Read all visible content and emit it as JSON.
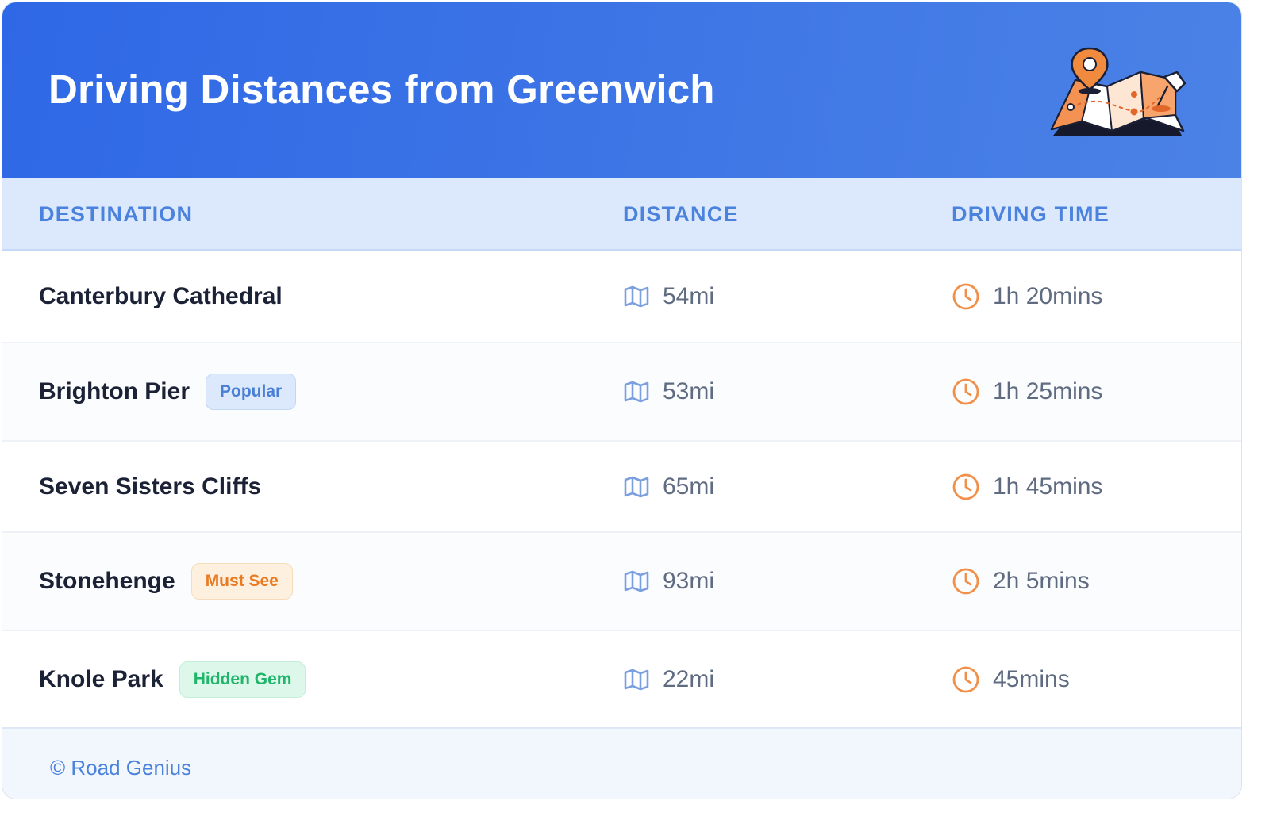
{
  "header": {
    "title": "Driving Distances from Greenwich",
    "illustration_icon": "map-with-pins-icon"
  },
  "columns": {
    "destination": "DESTINATION",
    "distance": "DISTANCE",
    "driving_time": "DRIVING TIME"
  },
  "rows": [
    {
      "destination": "Canterbury Cathedral",
      "badge": "",
      "distance": "54mi",
      "time": "1h 20mins"
    },
    {
      "destination": "Brighton Pier",
      "badge": "Popular",
      "distance": "53mi",
      "time": "1h 25mins"
    },
    {
      "destination": "Seven Sisters Cliffs",
      "badge": "",
      "distance": "65mi",
      "time": "1h 45mins"
    },
    {
      "destination": "Stonehenge",
      "badge": "Must See",
      "distance": "93mi",
      "time": "2h 5mins"
    },
    {
      "destination": "Knole Park",
      "badge": "Hidden Gem",
      "distance": "22mi",
      "time": "45mins"
    }
  ],
  "icons": {
    "distance": "map-icon",
    "time": "clock-icon"
  },
  "colors": {
    "header_gradient_start": "#2f68e6",
    "header_gradient_end": "#4b82e6",
    "column_header_text": "#4a82dd",
    "popular_badge": "#4a7fd6",
    "must_see_badge": "#ea7a22",
    "hidden_gem_badge": "#1fb56a",
    "clock_icon": "#f0904a",
    "map_icon": "#7a9fe0"
  },
  "footer": {
    "copyright": "© Road Genius"
  }
}
